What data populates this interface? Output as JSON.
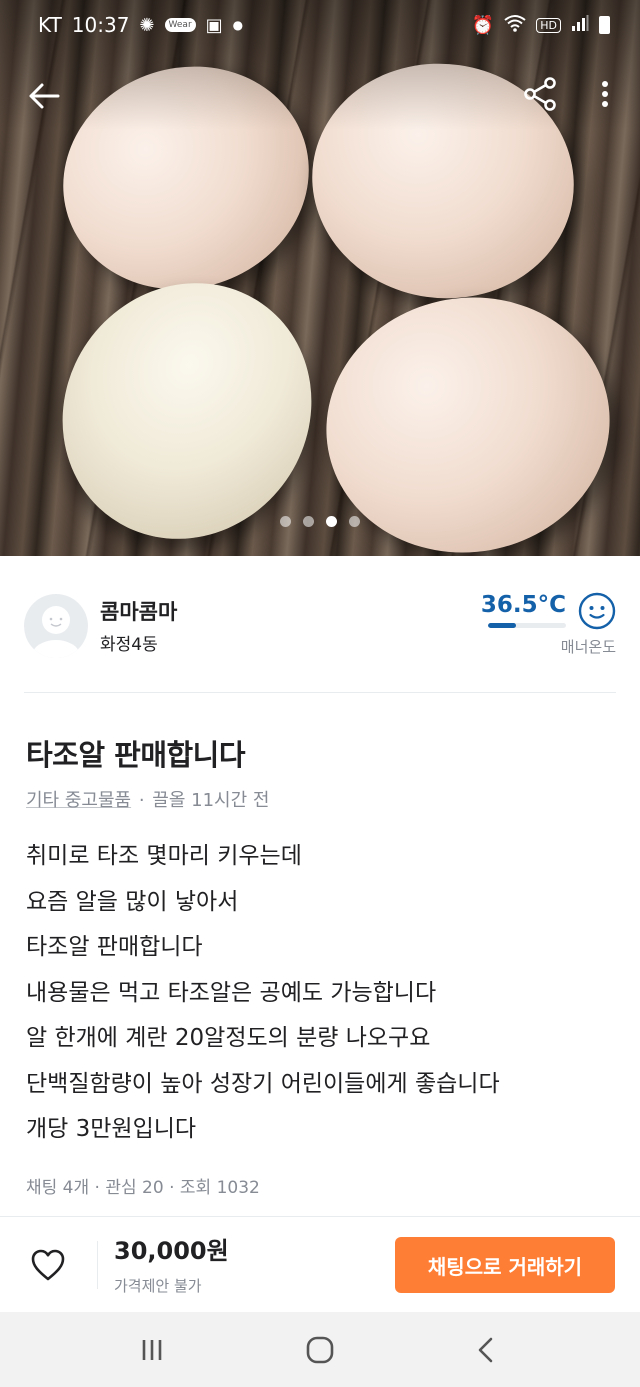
{
  "status_bar": {
    "carrier": "KT",
    "time": "10:37",
    "notification_badge": "Wear",
    "network_label": "HD",
    "icons": [
      "gear-icon",
      "image-icon",
      "alarm-icon",
      "wifi-icon",
      "signal-icon",
      "battery-icon"
    ]
  },
  "header": {
    "back_icon": "arrow-left-icon",
    "share_icon": "share-icon",
    "more_icon": "more-vertical-icon"
  },
  "carousel": {
    "total_pages": 4,
    "current_page": 3
  },
  "seller": {
    "name": "콤마콤마",
    "location": "화정4동",
    "temperature": "36.5°C",
    "temperature_level": 0.365,
    "temperature_label": "매너온도",
    "temperature_color": "#1561a9"
  },
  "post": {
    "title": "타조알 판매합니다",
    "category": "기타 중고물품",
    "time": "끌올 11시간 전",
    "description_lines": [
      "취미로 타조 몇마리 키우는데",
      "요즘 알을 많이 낳아서",
      "타조알 판매합니다",
      "내용물은 먹고 타조알은 공예도 가능합니다",
      "알 한개에 계란 20알정도의 분량 나오구요",
      "단백질함량이 높아 성장기 어린이들에게 좋습니다",
      "개당 3만원입니다"
    ],
    "stats": {
      "chats": "채팅 4개",
      "likes": "관심 20",
      "views": "조회 1032"
    }
  },
  "action_bar": {
    "price": "30,000원",
    "price_note": "가격제안 불가",
    "chat_button": "채팅으로 거래하기",
    "accent_color": "#ff7e36"
  },
  "system_nav": {
    "icons": [
      "recent-apps-icon",
      "home-icon",
      "back-icon"
    ]
  }
}
